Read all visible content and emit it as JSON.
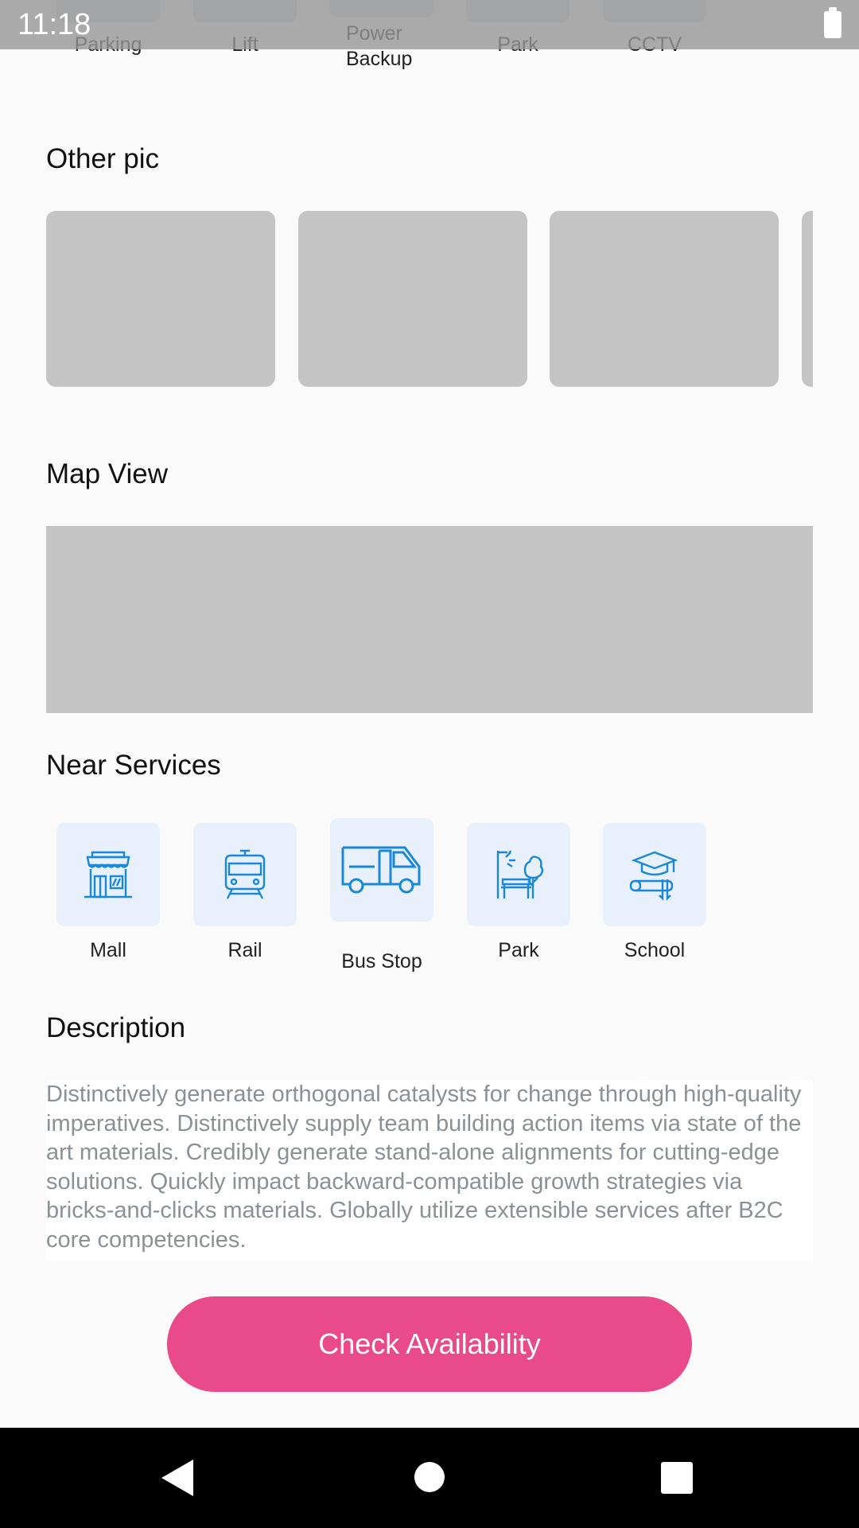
{
  "status_bar": {
    "time": "11:18"
  },
  "amenities": [
    {
      "label": "Parking"
    },
    {
      "label": "Lift"
    },
    {
      "label": "Power\nBackup"
    },
    {
      "label": "Park"
    },
    {
      "label": "CCTV"
    }
  ],
  "other_pic": {
    "title": "Other pic"
  },
  "map_view": {
    "title": "Map View"
  },
  "near_services": {
    "title": "Near Services",
    "items": [
      {
        "label": "Mall",
        "icon": "mall-icon"
      },
      {
        "label": "Rail",
        "icon": "rail-icon"
      },
      {
        "label": "Bus Stop",
        "icon": "bus-icon"
      },
      {
        "label": "Park",
        "icon": "park-icon"
      },
      {
        "label": "School",
        "icon": "school-icon"
      }
    ]
  },
  "description": {
    "title": "Description",
    "text": "Distinctively generate orthogonal catalysts for change through high-quality imperatives. Distinctively supply team building action items via state of the art materials. Credibly generate stand-alone alignments for cutting-edge solutions. Quickly impact backward-compatible growth strategies via bricks-and-clicks materials. Globally utilize extensible services after B2C core competencies."
  },
  "actions": {
    "check_availability": "Check Availability"
  },
  "colors": {
    "accent": "#e94b8a",
    "icon_blue": "#1a88d8",
    "tile_bg": "#e8f1fb"
  }
}
